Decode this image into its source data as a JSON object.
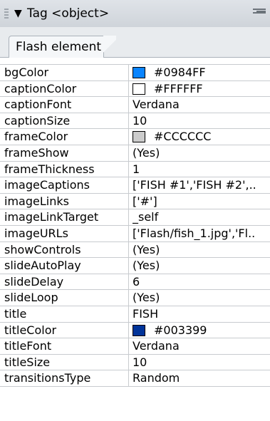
{
  "panel": {
    "title": "Tag <object>",
    "tab_label": "Flash element"
  },
  "rows": [
    {
      "name": "bgColor",
      "value": "#0984FF",
      "swatch": "#0984FF"
    },
    {
      "name": "captionColor",
      "value": "#FFFFFF",
      "swatch": "#FFFFFF"
    },
    {
      "name": "captionFont",
      "value": "Verdana"
    },
    {
      "name": "captionSize",
      "value": "10"
    },
    {
      "name": "frameColor",
      "value": "#CCCCCC",
      "swatch": "#CCCCCC"
    },
    {
      "name": "frameShow",
      "value": "(Yes)"
    },
    {
      "name": "frameThickness",
      "value": "1"
    },
    {
      "name": "imageCaptions",
      "value": "['FISH #1','FISH #2',.."
    },
    {
      "name": "imageLinks",
      "value": "['#']"
    },
    {
      "name": "imageLinkTarget",
      "value": "_self"
    },
    {
      "name": "imageURLs",
      "value": "['Flash/fish_1.jpg','Fl.."
    },
    {
      "name": "showControls",
      "value": "(Yes)"
    },
    {
      "name": "slideAutoPlay",
      "value": "(Yes)"
    },
    {
      "name": "slideDelay",
      "value": "6"
    },
    {
      "name": "slideLoop",
      "value": "(Yes)"
    },
    {
      "name": "title",
      "value": "FISH"
    },
    {
      "name": "titleColor",
      "value": "#003399",
      "swatch": "#003399"
    },
    {
      "name": "titleFont",
      "value": "Verdana"
    },
    {
      "name": "titleSize",
      "value": "10"
    },
    {
      "name": "transitionsType",
      "value": "Random"
    }
  ]
}
